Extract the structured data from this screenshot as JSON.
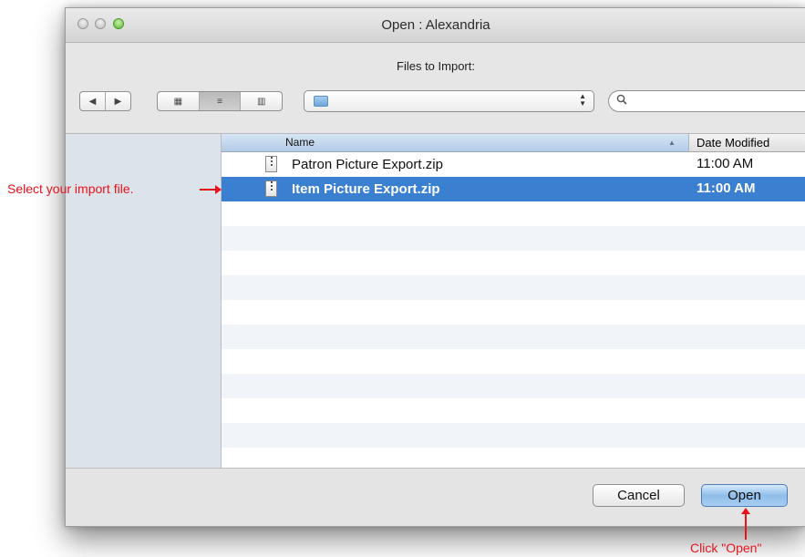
{
  "window": {
    "title": "Open : Alexandria"
  },
  "dialog": {
    "subtitle": "Files to Import:"
  },
  "toolbar": {
    "nav": [
      "◀",
      "▶"
    ],
    "views": [
      "▦",
      "≡",
      "▥"
    ],
    "active_view_index": 1,
    "path_popup_value": "",
    "search_value": ""
  },
  "file_list": {
    "columns": {
      "name": "Name",
      "date_modified": "Date Modified"
    },
    "rows": [
      {
        "name": "Patron Picture Export.zip",
        "date": "11:00 AM",
        "selected": false
      },
      {
        "name": "Item Picture Export.zip",
        "date": "11:00 AM",
        "selected": true
      }
    ]
  },
  "buttons": {
    "cancel": "Cancel",
    "open": "Open"
  },
  "annotations": {
    "select_file": "Select your import file.",
    "click_open": "Click \"Open\""
  },
  "colors": {
    "selection": "#3a7fd0",
    "annotation": "#e8121b",
    "default_button": "#8fbde9"
  }
}
